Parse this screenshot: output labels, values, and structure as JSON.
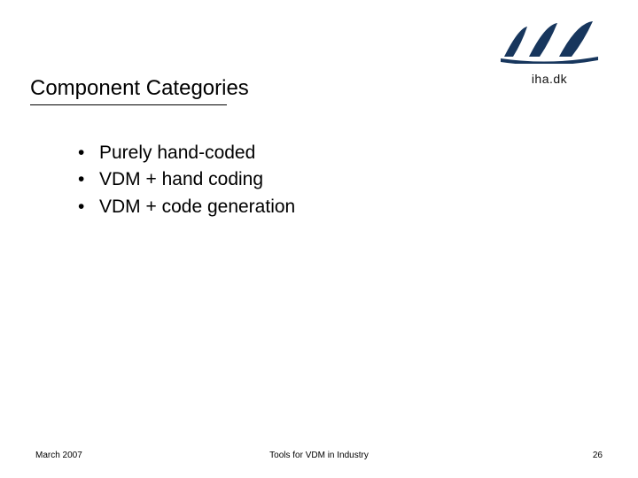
{
  "header": {
    "logo_text": "iha.dk"
  },
  "title": "Component Categories",
  "bullets": [
    "Purely hand-coded",
    "VDM + hand coding",
    "VDM + code generation"
  ],
  "footer": {
    "left": "March 2007",
    "center": "Tools for VDM in Industry",
    "right": "26"
  }
}
